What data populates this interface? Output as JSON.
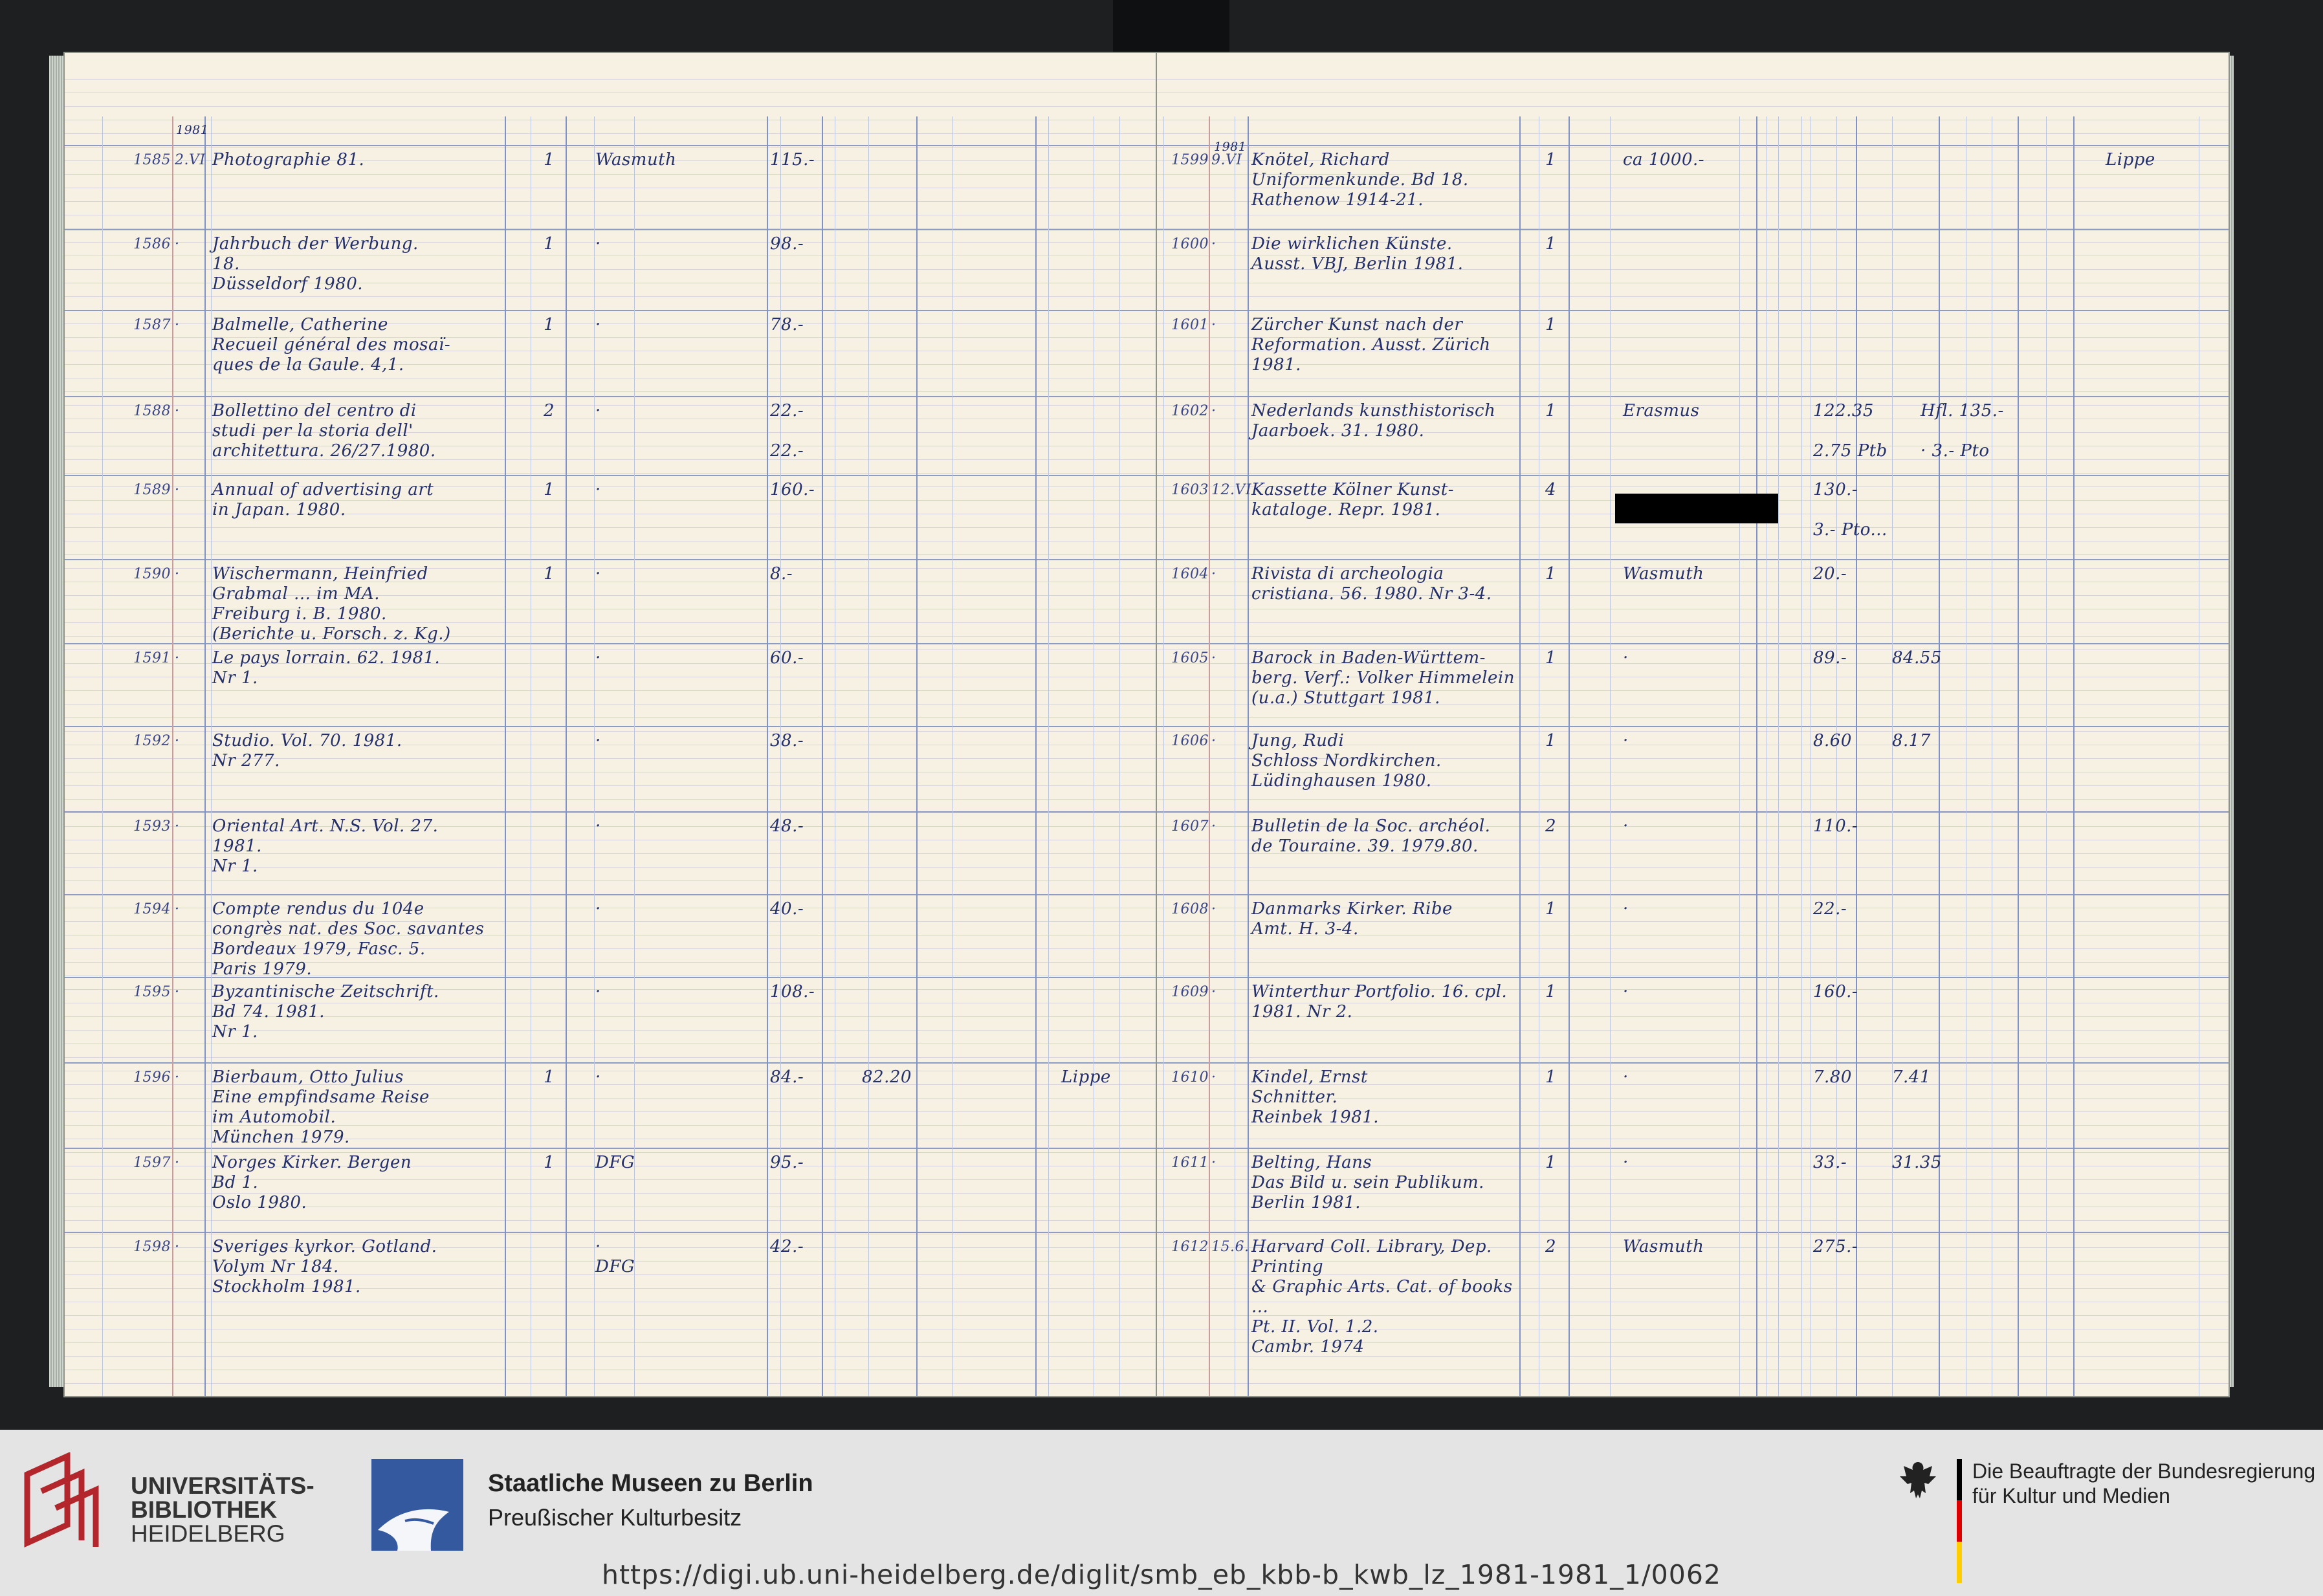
{
  "ledger": {
    "left_page": {
      "year_header": "1981",
      "entries": [
        {
          "no": "1585",
          "date": "2.VI",
          "text": "Photographie 81.",
          "qty": "1",
          "dealer": "Wasmuth",
          "price": "115.-",
          "extra": "",
          "remark": ""
        },
        {
          "no": "1586",
          "date": "·",
          "text": "Jahrbuch der Werbung.\n18.\nDüsseldorf 1980.",
          "qty": "1",
          "dealer": "·",
          "price": "98.-",
          "extra": "",
          "remark": ""
        },
        {
          "no": "1587",
          "date": "·",
          "text": "Balmelle, Catherine\nRecueil général des mosaï-\nques de la Gaule. 4,1.",
          "qty": "1",
          "dealer": "·",
          "price": "78.-",
          "extra": "",
          "remark": ""
        },
        {
          "no": "1588",
          "date": "·",
          "text": "Bollettino del centro di\nstudi per la storia dell'\narchitettura. 26/27.1980.",
          "qty": "2",
          "dealer": "·",
          "price": "22.-\n\n22.-",
          "extra": "",
          "remark": ""
        },
        {
          "no": "1589",
          "date": "·",
          "text": "Annual of advertising art\nin Japan. 1980.",
          "qty": "1",
          "dealer": "·",
          "price": "160.-",
          "extra": "",
          "remark": ""
        },
        {
          "no": "1590",
          "date": "·",
          "text": "Wischermann, Heinfried\nGrabmal ... im MA.\nFreiburg i. B. 1980.\n(Berichte u. Forsch. z. Kg.)",
          "qty": "1",
          "dealer": "·",
          "price": "8.-",
          "extra": "",
          "remark": ""
        },
        {
          "no": "1591",
          "date": "·",
          "text": "Le pays lorrain. 62. 1981.\nNr 1.",
          "qty": "",
          "dealer": "·",
          "price": "60.-",
          "extra": "",
          "remark": ""
        },
        {
          "no": "1592",
          "date": "·",
          "text": "Studio. Vol. 70. 1981.\nNr 277.",
          "qty": "",
          "dealer": "·",
          "price": "38.-",
          "extra": "",
          "remark": ""
        },
        {
          "no": "1593",
          "date": "·",
          "text": "Oriental Art. N.S. Vol. 27.\n1981.\nNr 1.",
          "qty": "",
          "dealer": "·",
          "price": "48.-",
          "extra": "",
          "remark": ""
        },
        {
          "no": "1594",
          "date": "·",
          "text": "Compte rendus du 104e\ncongrès nat. des Soc. savantes\nBordeaux 1979, Fasc. 5.\nParis 1979.",
          "qty": "",
          "dealer": "·",
          "price": "40.-",
          "extra": "",
          "remark": ""
        },
        {
          "no": "1595",
          "date": "·",
          "text": "Byzantinische Zeitschrift.\nBd 74. 1981.\nNr 1.",
          "qty": "",
          "dealer": "·",
          "price": "108.-",
          "extra": "",
          "remark": ""
        },
        {
          "no": "1596",
          "date": "·",
          "text": "Bierbaum, Otto Julius\nEine empfindsame Reise\nim Automobil.\nMünchen 1979.",
          "qty": "1",
          "dealer": "·",
          "price": "84.-",
          "extra": "82.20",
          "remark": "Lippe"
        },
        {
          "no": "1597",
          "date": "·",
          "text": "Norges Kirker. Bergen\nBd 1.\nOslo 1980.",
          "qty": "1",
          "dealer": "DFG",
          "price": "95.-",
          "extra": "",
          "remark": ""
        },
        {
          "no": "1598",
          "date": "·",
          "text": "Sveriges kyrkor. Gotland.\nVolym Nr 184.\nStockholm 1981.",
          "qty": "",
          "dealer": "·\nDFG",
          "price": "42.-",
          "extra": "",
          "remark": ""
        }
      ]
    },
    "right_page": {
      "year_header": "1981",
      "entries": [
        {
          "no": "1599",
          "date": "9.VI",
          "text": "Knötel, Richard\nUniformenkunde. Bd 18.\nRathenow 1914-21.",
          "qty": "1",
          "dealer": "ca 1000.-",
          "price": "",
          "net": "",
          "note": "",
          "remark": "Lippe"
        },
        {
          "no": "1600",
          "date": "·",
          "text": "Die wirklichen Künste.\nAusst. VBJ, Berlin 1981.",
          "qty": "1",
          "dealer": "",
          "price": "",
          "net": "",
          "note": "",
          "remark": ""
        },
        {
          "no": "1601",
          "date": "·",
          "text": "Zürcher Kunst nach der\nReformation. Ausst. Zürich\n1981.",
          "qty": "1",
          "dealer": "",
          "price": "",
          "net": "",
          "note": "",
          "remark": ""
        },
        {
          "no": "1602",
          "date": "·",
          "text": "Nederlands kunsthistorisch\nJaarboek. 31. 1980.",
          "qty": "1",
          "dealer": "Erasmus",
          "price": "122.35\n\n2.75 Ptb",
          "net": "",
          "note": "Hfl. 135.-\n\n· 3.- Pto",
          "remark": ""
        },
        {
          "no": "1603",
          "date": "12.VI",
          "text": "Kassette Kölner Kunst-\nkataloge. Repr. 1981.",
          "qty": "4",
          "dealer": "",
          "price": "130.-\n\n3.- Pto...",
          "net": "",
          "note": "",
          "remark": ""
        },
        {
          "no": "1604",
          "date": "·",
          "text": "Rivista di archeologia\ncristiana. 56. 1980. Nr 3-4.",
          "qty": "1",
          "dealer": "Wasmuth",
          "price": "20.-",
          "net": "",
          "note": "",
          "remark": ""
        },
        {
          "no": "1605",
          "date": "·",
          "text": "Barock in Baden-Württem-\nberg. Verf.: Volker Himmelein\n(u.a.) Stuttgart 1981.",
          "qty": "1",
          "dealer": "·",
          "price": "89.-",
          "net": "84.55",
          "note": "",
          "remark": ""
        },
        {
          "no": "1606",
          "date": "·",
          "text": "Jung, Rudi\nSchloss Nordkirchen.\nLüdinghausen 1980.",
          "qty": "1",
          "dealer": "·",
          "price": "8.60",
          "net": "8.17",
          "note": "",
          "remark": ""
        },
        {
          "no": "1607",
          "date": "·",
          "text": "Bulletin de la Soc. archéol.\nde Touraine. 39. 1979.80.",
          "qty": "2",
          "dealer": "·",
          "price": "110.-",
          "net": "",
          "note": "",
          "remark": ""
        },
        {
          "no": "1608",
          "date": "·",
          "text": "Danmarks Kirker. Ribe\nAmt. H. 3-4.",
          "qty": "1",
          "dealer": "·",
          "price": "22.-",
          "net": "",
          "note": "",
          "remark": ""
        },
        {
          "no": "1609",
          "date": "·",
          "text": "Winterthur Portfolio. 16. cpl.\n1981. Nr 2.",
          "qty": "1",
          "dealer": "·",
          "price": "160.-",
          "net": "",
          "note": "",
          "remark": ""
        },
        {
          "no": "1610",
          "date": "·",
          "text": "Kindel, Ernst\nSchnitter.\nReinbek 1981.",
          "qty": "1",
          "dealer": "·",
          "price": "7.80",
          "net": "7.41",
          "note": "",
          "remark": ""
        },
        {
          "no": "1611",
          "date": "·",
          "text": "Belting, Hans\nDas Bild u. sein Publikum.\nBerlin 1981.",
          "qty": "1",
          "dealer": "·",
          "price": "33.-",
          "net": "31.35",
          "note": "",
          "remark": ""
        },
        {
          "no": "1612",
          "date": "15.6.",
          "text": "Harvard Coll. Library, Dep. Printing\n& Graphic Arts. Cat. of books ...\nPt. II. Vol. 1.2.\nCambr. 1974",
          "qty": "2",
          "dealer": "Wasmuth",
          "price": "275.-",
          "net": "",
          "note": "",
          "remark": ""
        }
      ]
    }
  },
  "footer": {
    "ub_line1": "UNIVERSITÄTS-",
    "ub_line2": "BIBLIOTHEK",
    "ub_line3": "HEIDELBERG",
    "smb_title": "Staatliche Museen zu Berlin",
    "smb_subtitle": "Preußischer Kulturbesitz",
    "bkm_line1": "Die Beauftragte der Bundesregierung",
    "bkm_line2": "für Kultur und Medien",
    "url": "https://digi.ub.uni-heidelberg.de/diglit/smb_eb_kbb-b_kwb_lz_1981-1981_1/0062"
  },
  "colors": {
    "paper": "#f7f1e3",
    "ink": "#24306b",
    "rule_blue": "#7f93c8",
    "footer_bg": "#e4e4e4",
    "smb_blue": "#34599f",
    "ub_red": "#b3262b"
  }
}
